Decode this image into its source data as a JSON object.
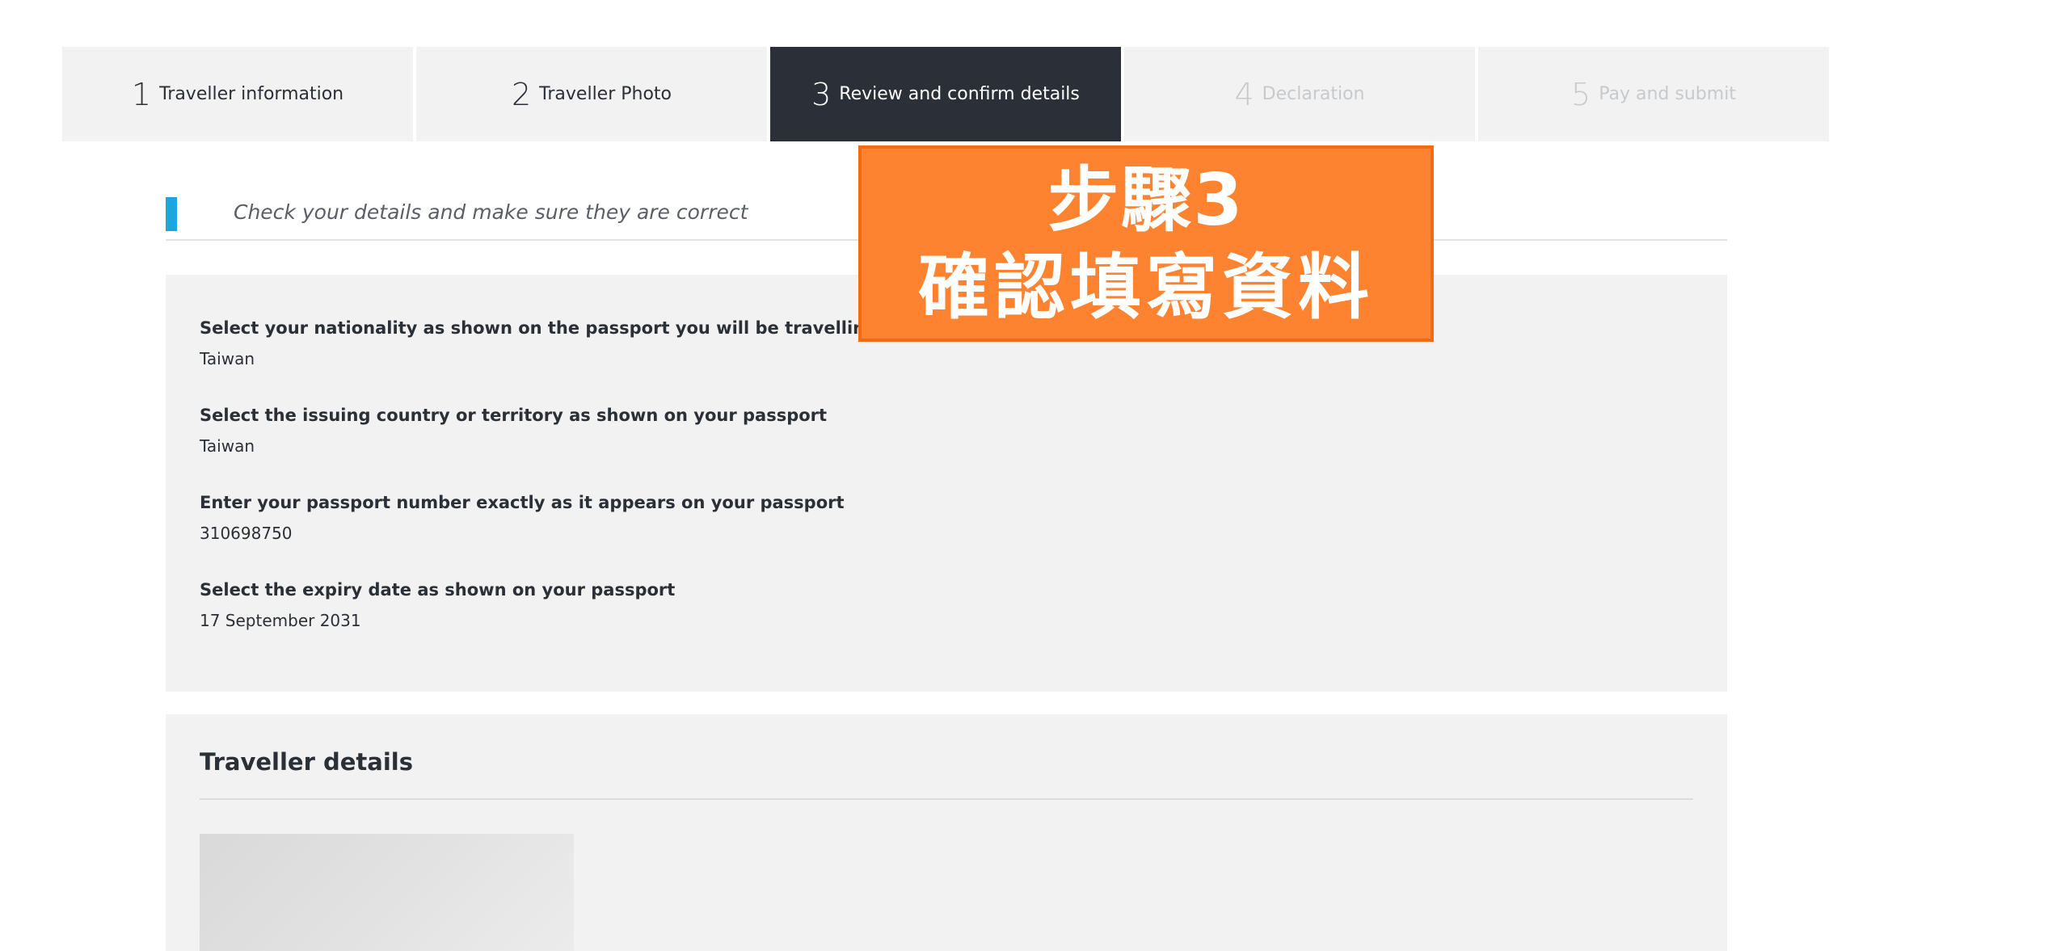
{
  "stepper": {
    "steps": [
      {
        "num": "1",
        "label": "Traveller information",
        "state": "done"
      },
      {
        "num": "2",
        "label": "Traveller Photo",
        "state": "done"
      },
      {
        "num": "3",
        "label": "Review and confirm details",
        "state": "active"
      },
      {
        "num": "4",
        "label": "Declaration",
        "state": "disabled"
      },
      {
        "num": "5",
        "label": "Pay and submit",
        "state": "disabled"
      }
    ]
  },
  "review": {
    "heading": "Check your details and make sure they are correct"
  },
  "passport": {
    "fields": [
      {
        "question": "Select your nationality as shown on the passport you will be travelling on",
        "answer": "Taiwan"
      },
      {
        "question": "Select the issuing country or territory as shown on your passport",
        "answer": "Taiwan"
      },
      {
        "question": "Enter your passport number exactly as it appears on your passport",
        "answer": "310698750"
      },
      {
        "question": "Select the expiry date as shown on your passport",
        "answer": "17 September 2031"
      }
    ]
  },
  "traveller": {
    "title": "Traveller details"
  },
  "overlay": {
    "line1": "步驟3",
    "line2": "確認填寫資料"
  },
  "colors": {
    "accent": "#1ba7de",
    "active_step": "#2a2f38",
    "overlay": "#fd8331",
    "panel": "#f2f2f2"
  }
}
